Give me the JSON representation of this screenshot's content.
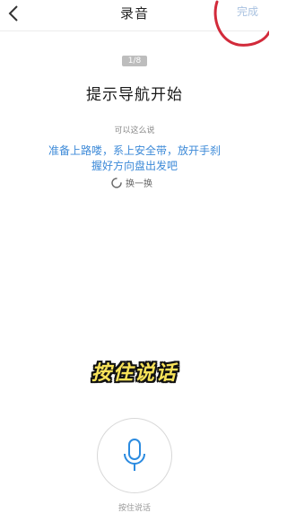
{
  "header": {
    "title": "录音",
    "done_label": "完成",
    "back_icon": "chevron-left-icon"
  },
  "step": {
    "counter": "1/8",
    "prompt_title": "提示导航开始"
  },
  "example": {
    "label": "可以这么说",
    "line1": "准备上路喽，系上安全带，放开手刹",
    "line2": "握好方向盘出发吧",
    "refresh_label": "换一换",
    "refresh_icon": "refresh-spinner-icon"
  },
  "overlay": {
    "caption": "按住说话"
  },
  "record": {
    "mic_icon": "microphone-icon",
    "hint": "按住说话"
  },
  "colors": {
    "accent_blue": "#3d8ad8",
    "done_disabled": "#a9c2e0",
    "annotation_red": "#d22a3a",
    "caption_yellow": "#f7e259"
  }
}
